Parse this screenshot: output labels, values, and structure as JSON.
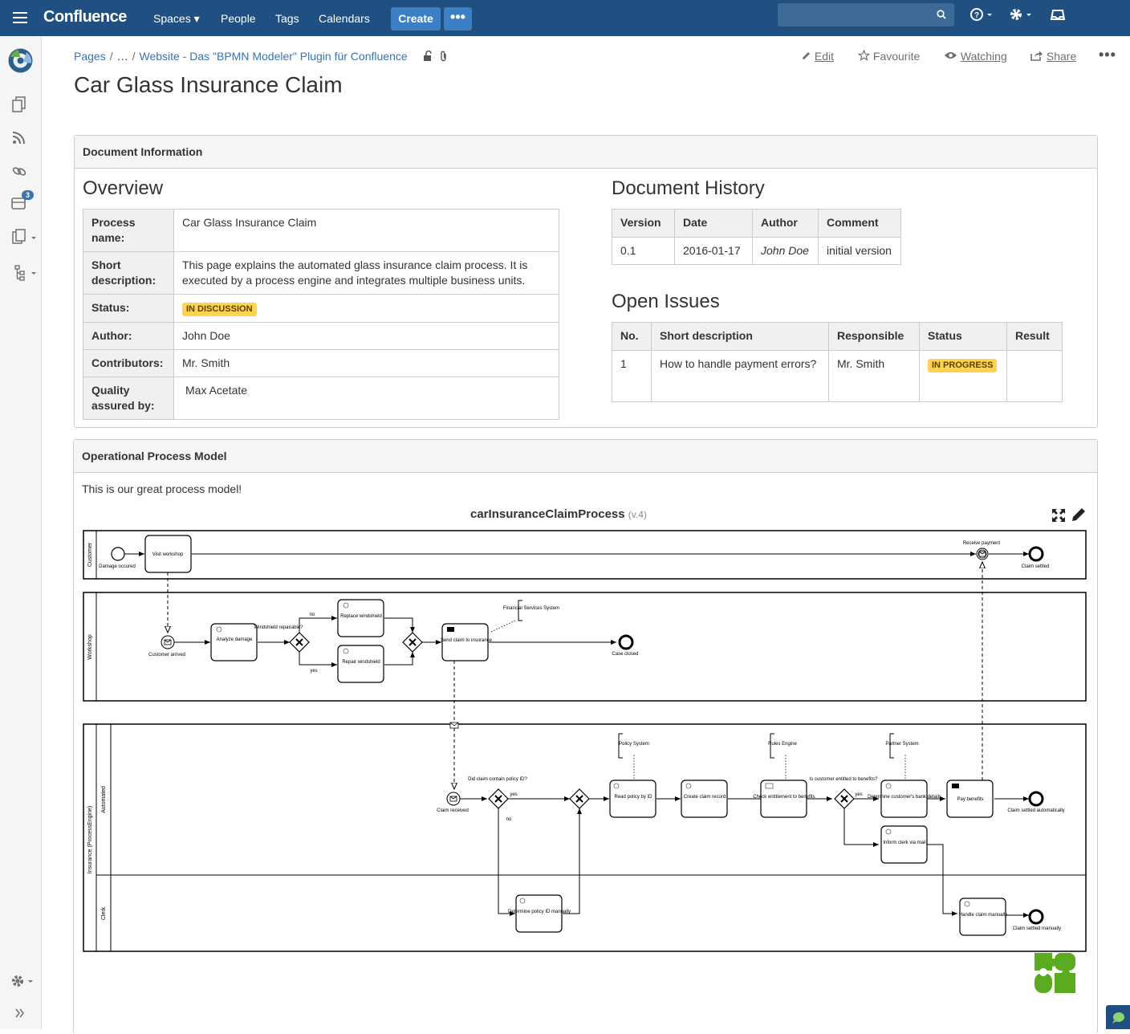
{
  "topbar": {
    "logo": "Confluence",
    "nav": [
      "Spaces ▾",
      "People",
      "Tags",
      "Calendars"
    ],
    "create": "Create",
    "more": "•••"
  },
  "breadcrumb": {
    "root": "Pages",
    "ellipsis": "…",
    "parent": "Website - Das \"BPMN Modeler\" Plugin für Confluence"
  },
  "actions": {
    "edit": "Edit",
    "favourite": "Favourite",
    "watching": "Watching",
    "share": "Share"
  },
  "title": "Car Glass Insurance Claim",
  "doc_info": {
    "header": "Document Information",
    "overview_heading": "Overview",
    "rows": [
      {
        "label": "Process name:",
        "value": "Car Glass Insurance Claim"
      },
      {
        "label": "Short description:",
        "value": "This page explains the automated glass insurance claim process. It is executed by a process engine and integrates multiple business units."
      },
      {
        "label": "Status:",
        "value": "IN DISCUSSION"
      },
      {
        "label": "Author:",
        "value": "John Doe"
      },
      {
        "label": "Contributors:",
        "value": "Mr. Smith"
      },
      {
        "label": "Quality assured by:",
        "value": "Max Acetate"
      }
    ],
    "history_heading": "Document History",
    "history_cols": [
      "Version",
      "Date",
      "Author",
      "Comment"
    ],
    "history_rows": [
      [
        "0.1",
        "2016-01-17",
        "John Doe",
        "initial version"
      ]
    ],
    "issues_heading": "Open Issues",
    "issues_cols": [
      "No.",
      "Short description",
      "Responsible",
      "Status",
      "Result"
    ],
    "issues_rows": [
      [
        "1",
        "How to handle payment errors?",
        "Mr. Smith",
        "IN PROGRESS",
        ""
      ]
    ]
  },
  "process_model": {
    "header": "Operational Process Model",
    "intro": "This is our great process model!",
    "diagram_name": "carInsuranceClaimProcess",
    "diagram_version": "(v.4)",
    "lanes": {
      "customer": "Customer",
      "workshop": "Workshop",
      "insurance": "Insurance (ProcessEngine)",
      "automated": "Automated",
      "clerk": "Clerk"
    },
    "labels": {
      "damage": "Damage occured",
      "visit": "Visit workshop",
      "receive_payment": "Receive payment",
      "claim_settled": "Claim settled",
      "customer_arrived": "Customer arrived",
      "analyze": "Analyze damage",
      "windshield_q": "Windshield repairable?",
      "no": "no",
      "yes": "yes",
      "replace": "Replace windshield",
      "repair": "Repair windshield",
      "send_claim": "Send claim to insurance",
      "financial": "Financial Services System",
      "case_closed": "Case closed",
      "claim_received": "Claim received",
      "policy_q": "Did claim contain policy ID?",
      "read_policy": "Read policy by ID",
      "create_claim": "Create claim record",
      "check": "Check entitlement to benefits",
      "entitled_q": "Is customer entitled to benefits?",
      "determine_bank": "Determine customer's bank details",
      "pay": "Pay benefits",
      "settled_auto": "Claim settled automatically",
      "policy_system": "Policy System",
      "rules_engine": "Rules Engine",
      "partner_system": "Partner System",
      "inform_clerk": "Inform clerk via mail",
      "determine_manual": "Determine policy ID manually",
      "handle_manual": "Handle claim manually",
      "settled_manual": "Claim settled manually"
    }
  }
}
